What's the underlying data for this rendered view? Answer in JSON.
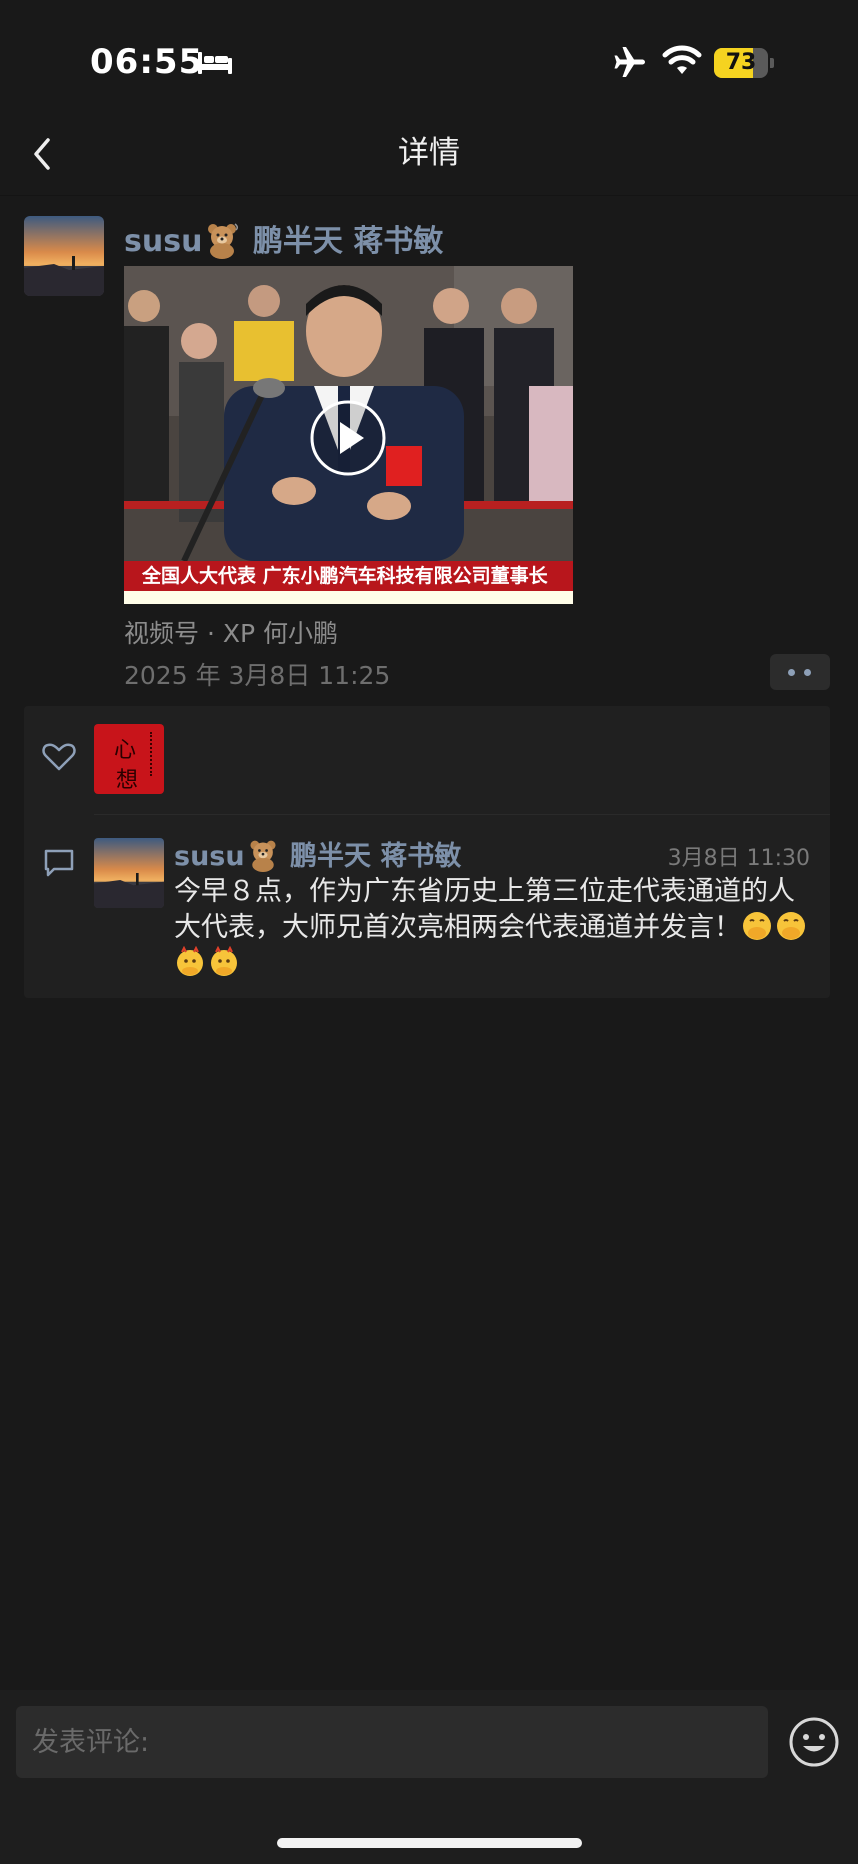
{
  "status_bar": {
    "time": "06:55",
    "battery": "73",
    "battery_level": 0.73,
    "icons": [
      "bed-icon",
      "airplane-icon",
      "wifi-icon",
      "battery-icon"
    ]
  },
  "nav": {
    "title": "详情",
    "back_icon": "chevron-left-icon"
  },
  "post": {
    "author": "susu",
    "author_suffix": "鹏半天 蒋书敏",
    "video": {
      "caption": "全国人大代表 广东小鹏汽车科技有限公司董事长",
      "play_icon": "play-icon"
    },
    "channel": "视频号 · XP 何小鹏",
    "date": "2025 年 3月8日 11:25",
    "more_icon": "more-dots-icon"
  },
  "likes": {
    "icon": "heart-icon",
    "liker_avatar_text": [
      "心",
      "想"
    ]
  },
  "comment": {
    "icon": "comment-icon",
    "author": "susu",
    "author_suffix": "鹏半天 蒋书敏",
    "time": "3月8日 11:30",
    "text": "今早８点，作为广东省历史上第三位走代表通道的人大代表，大师兄首次亮相两会代表通道并发言！"
  },
  "composer": {
    "placeholder": "发表评论:",
    "emoji_icon": "smiley-icon"
  },
  "colors": {
    "background": "#191919",
    "name_blue": "#7d90a9",
    "battery_yellow": "#f5d320"
  }
}
